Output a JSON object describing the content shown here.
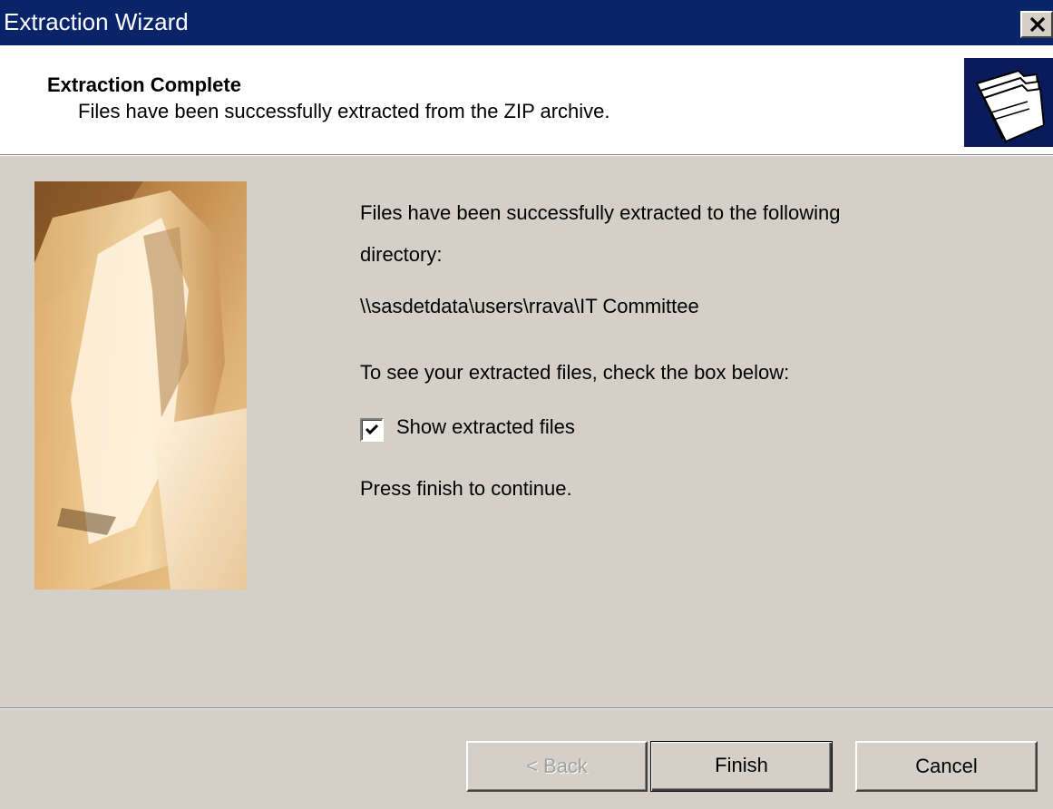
{
  "window": {
    "title": "Extraction Wizard",
    "close_label": "×"
  },
  "header": {
    "title": "Extraction Complete",
    "subtitle": "Files have been successfully extracted from the ZIP archive.",
    "icon": "folders-icon"
  },
  "content": {
    "message_line1": "Files have been successfully extracted to the following",
    "message_line2": "directory:",
    "directory": "\\\\sasdetdata\\users\\rrava\\IT Committee",
    "check_prompt": "To see your extracted files, check the box below:",
    "show_files_label": "Show extracted files",
    "show_files_checked": true,
    "continue_text": "Press finish to continue."
  },
  "buttons": {
    "back": "< Back",
    "finish": "Finish",
    "cancel": "Cancel"
  },
  "colors": {
    "titlebar": "#0a246a",
    "dialog_bg": "#d4d0c8",
    "disabled_text": "#a0a0a0"
  }
}
